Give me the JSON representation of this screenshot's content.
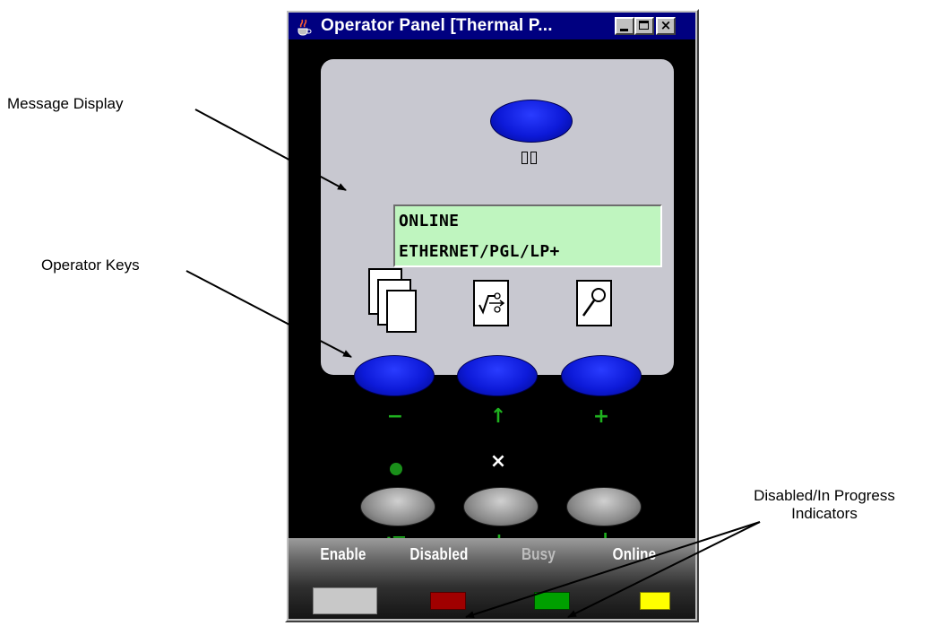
{
  "callouts": {
    "message_display": "Message Display",
    "operator_keys": "Operator Keys",
    "indicators_line1": "Disabled/In Progress",
    "indicators_line2": "Indicators"
  },
  "window": {
    "title": "Operator Panel [Thermal P...",
    "min_label": "",
    "max_label": "",
    "close_label": "×",
    "app_icon": "java-cup-icon"
  },
  "panel": {
    "top_key_icon": "pause-icon",
    "lcd": {
      "line1": "ONLINE",
      "line2": "ETHERNET/PGL/LP+"
    },
    "operator_keys": [
      {
        "icon": "copies-icon",
        "label": "−"
      },
      {
        "icon": "calibrate-icon",
        "label": "↑"
      },
      {
        "icon": "search-icon",
        "label": "+"
      }
    ],
    "secondary_keys": [
      {
        "top_mark": "●",
        "bottom_label": "⁝☰"
      },
      {
        "top_mark": "×",
        "bottom_label": "↓"
      },
      {
        "top_mark": "",
        "bottom_label": "↲"
      }
    ],
    "status_bar": {
      "labels": [
        "Enable",
        "Disabled",
        "Busy",
        "Online"
      ],
      "colors": {
        "enable": "#c8c8c8",
        "disabled": "#a00000",
        "busy": "#00a000",
        "online": "#ffff00"
      }
    }
  },
  "colors": {
    "key_label": "#1fb11f",
    "lcd_background": "#bff5bf",
    "titlebar": "#000080"
  }
}
